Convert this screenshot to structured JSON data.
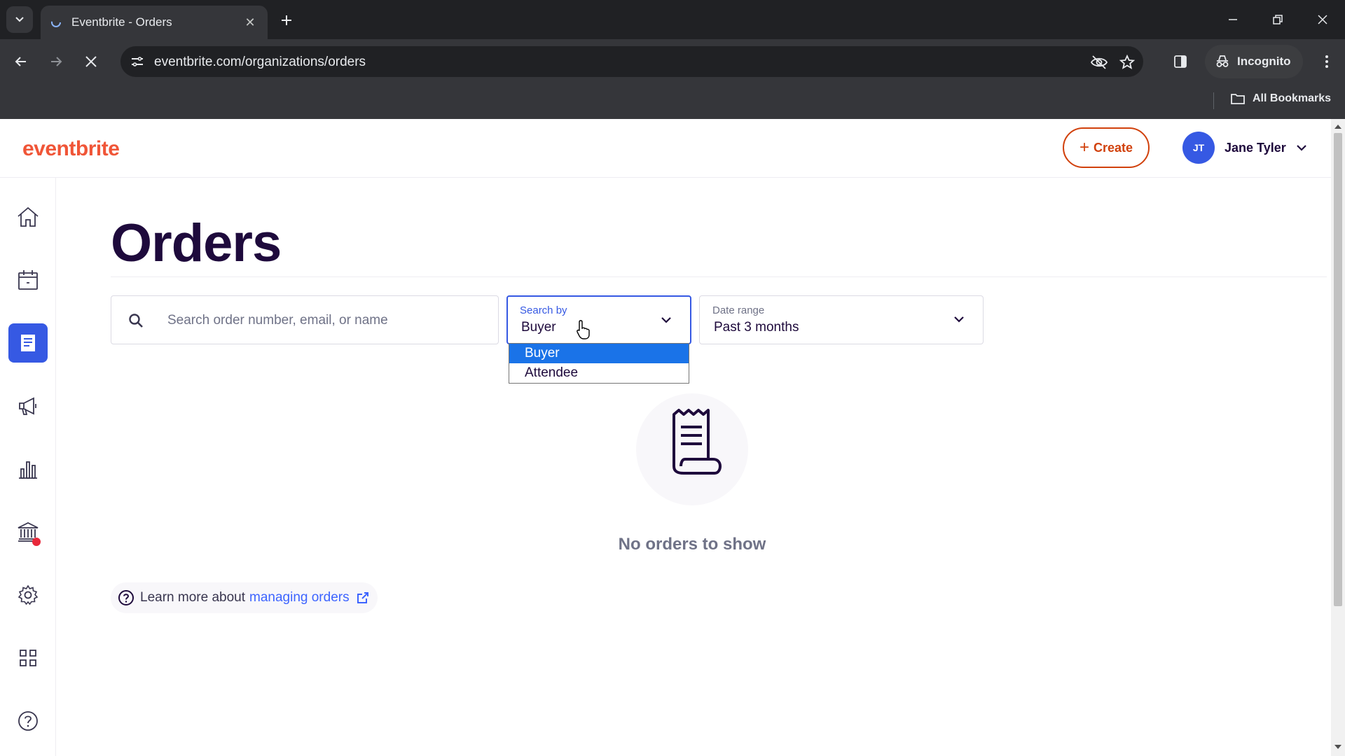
{
  "browser": {
    "tab_title": "Eventbrite - Orders",
    "url": "eventbrite.com/organizations/orders",
    "incognito_label": "Incognito",
    "bookmarks_label": "All Bookmarks"
  },
  "header": {
    "logo": "eventbrite",
    "create_label": "Create",
    "user_initials": "JT",
    "user_name": "Jane Tyler"
  },
  "sidebar": {
    "items": [
      {
        "name": "home",
        "icon": "home-icon",
        "active": false
      },
      {
        "name": "events",
        "icon": "calendar-icon",
        "active": false
      },
      {
        "name": "orders",
        "icon": "orders-icon",
        "active": true
      },
      {
        "name": "marketing",
        "icon": "megaphone-icon",
        "active": false
      },
      {
        "name": "reports",
        "icon": "bar-chart-icon",
        "active": false
      },
      {
        "name": "finance",
        "icon": "bank-icon",
        "active": false,
        "notification": true
      },
      {
        "name": "settings",
        "icon": "gear-icon",
        "active": false
      },
      {
        "name": "apps",
        "icon": "grid-icon",
        "active": false
      },
      {
        "name": "help",
        "icon": "help-icon",
        "active": false
      }
    ]
  },
  "main": {
    "title": "Orders",
    "search": {
      "placeholder": "Search order number, email, or name",
      "value": ""
    },
    "search_by": {
      "label": "Search by",
      "value": "Buyer",
      "options": [
        "Buyer",
        "Attendee"
      ],
      "selected_option": "Buyer"
    },
    "date_range": {
      "label": "Date range",
      "value": "Past 3 months"
    },
    "empty_state": {
      "text": "No orders to show"
    },
    "learn_more": {
      "prefix": "Learn more about",
      "link_text": "managing orders"
    }
  },
  "colors": {
    "brand": "#f05537",
    "accent": "#3659e3",
    "link": "#3d64ff",
    "title": "#1e0a3c"
  }
}
